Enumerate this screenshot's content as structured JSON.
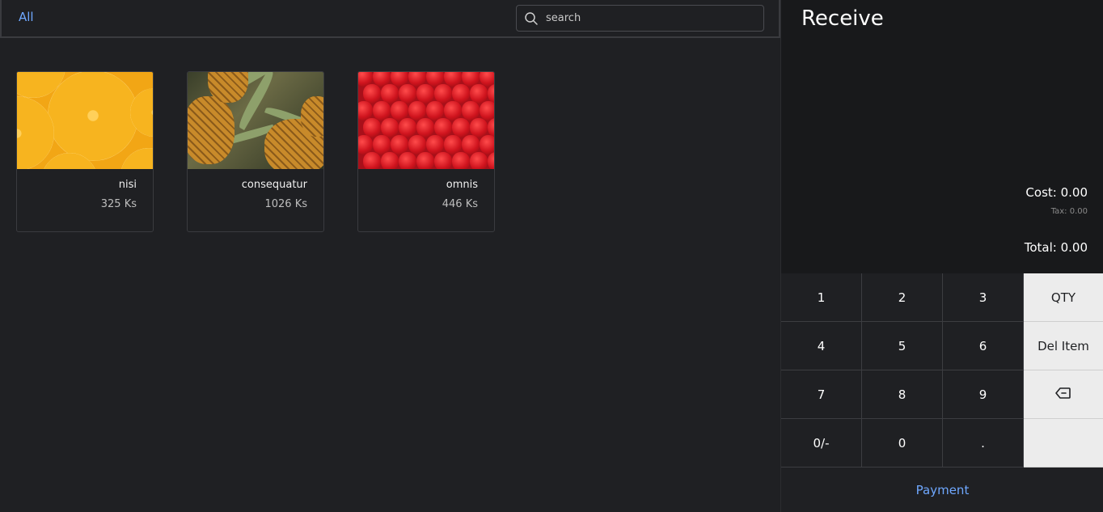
{
  "categories": {
    "all_label": "All"
  },
  "search": {
    "placeholder": "search",
    "icon": "search-icon"
  },
  "products": [
    {
      "name": "nisi",
      "price": "325 Ks",
      "image": "orange-slices"
    },
    {
      "name": "consequatur",
      "price": "1026 Ks",
      "image": "pineapples"
    },
    {
      "name": "omnis",
      "price": "446 Ks",
      "image": "strawberries"
    }
  ],
  "receipt": {
    "title": "Receive",
    "cost": "Cost: 0.00",
    "tax": "Tax: 0.00",
    "total": "Total: 0.00"
  },
  "keypad": {
    "k1": "1",
    "k2": "2",
    "k3": "3",
    "qty": "QTY",
    "k4": "4",
    "k5": "5",
    "k6": "6",
    "del_item": "Del Item",
    "k7": "7",
    "k8": "8",
    "k9": "9",
    "backspace_icon": "backspace-icon",
    "sign": "0/-",
    "k0": "0",
    "dot": ".",
    "blank": ""
  },
  "payment_label": "Payment",
  "colors": {
    "accent": "#6fa8ff",
    "background": "#1f2023",
    "panel": "#18191b",
    "key_light": "#ececec"
  }
}
